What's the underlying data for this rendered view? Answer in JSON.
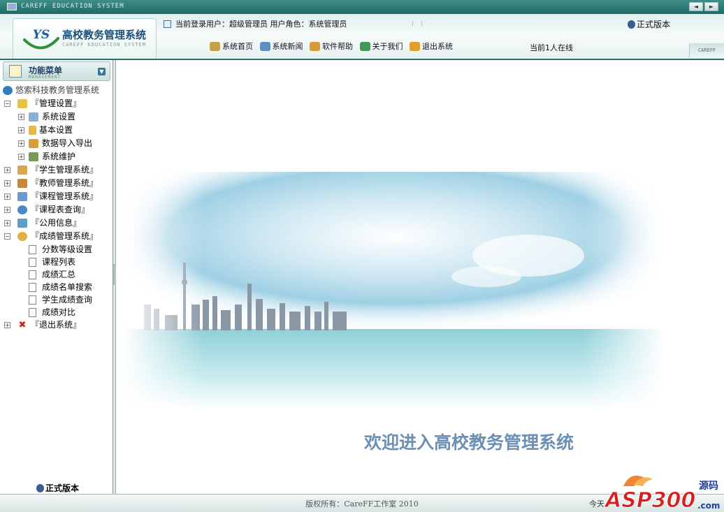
{
  "titlebar": {
    "title": "CAREFF EDUCATION SYSTEM",
    "buttons": [
      "◄",
      "►"
    ]
  },
  "header": {
    "logo_mark": "YS",
    "logo_title": "高校教务管理系统",
    "logo_subtitle": "CAREFF EDUCATION SYSTEM",
    "user_text": "当前登录用户：超级管理员  用户角色：系统管理员",
    "version": "正式版本",
    "nav": [
      {
        "label": "系统首页",
        "icon": "home-icon",
        "color": "#c8a048"
      },
      {
        "label": "系统新闻",
        "icon": "news-icon",
        "color": "#5f8fc0"
      },
      {
        "label": "软件帮助",
        "icon": "help-icon",
        "color": "#d79a38"
      },
      {
        "label": "关于我们",
        "icon": "about-icon",
        "color": "#3f9a58"
      },
      {
        "label": "退出系统",
        "icon": "exit-icon",
        "color": "#e0a030"
      }
    ],
    "online": "当前1人在线",
    "brand_tag": "CAREFF"
  },
  "sidebar": {
    "menu_title": "功能菜单",
    "menu_subtitle": "MANAGEMENT",
    "tree": [
      {
        "label": "悠索科技教务管理系统",
        "level": 0,
        "toggle": "",
        "icon": "globe-icon",
        "color": "#2e7fc0"
      },
      {
        "label": "『管理设置』",
        "level": 0,
        "toggle": "−",
        "icon": "folder-open-icon",
        "color": "#e7c34a"
      },
      {
        "label": "系统设置",
        "level": 1,
        "toggle": "+",
        "icon": "printer-icon",
        "color": "#8ab0d8"
      },
      {
        "label": "基本设置",
        "level": 1,
        "toggle": "+",
        "icon": "pencil-icon",
        "color": "#e8b84a"
      },
      {
        "label": "数据导入导出",
        "level": 1,
        "toggle": "+",
        "icon": "users-icon",
        "color": "#d8a03a"
      },
      {
        "label": "系统维护",
        "level": 1,
        "toggle": "+",
        "icon": "edit-doc-icon",
        "color": "#7a9a5a"
      },
      {
        "label": "『学生管理系统』",
        "level": 0,
        "toggle": "+",
        "icon": "student-icon",
        "color": "#d8a848"
      },
      {
        "label": "『教师管理系统』",
        "level": 0,
        "toggle": "+",
        "icon": "teacher-icon",
        "color": "#c8883a"
      },
      {
        "label": "『课程管理系统』",
        "level": 0,
        "toggle": "+",
        "icon": "table-icon",
        "color": "#6a9ad0"
      },
      {
        "label": "『课程表查询』",
        "level": 0,
        "toggle": "+",
        "icon": "magnifier-icon",
        "color": "#4a8ac8"
      },
      {
        "label": "『公用信息』",
        "level": 0,
        "toggle": "+",
        "icon": "info-icon",
        "color": "#5aa0c8"
      },
      {
        "label": "『成绩管理系统』",
        "level": 0,
        "toggle": "−",
        "icon": "pie-chart-icon",
        "color": "#e0b040"
      }
    ],
    "grade_children": [
      "分数等级设置",
      "课程列表",
      "成绩汇总",
      "成绩名单搜索",
      "学生成绩查询",
      "成绩对比"
    ],
    "exit_item": {
      "label": "『退出系统』",
      "toggle": "+",
      "icon": "close-red-icon",
      "color": "#d02020"
    },
    "version": "正式版本"
  },
  "main": {
    "welcome": "欢迎进入高校教务管理系统"
  },
  "statusbar": {
    "copyright": "版权所有：CareFF工作室 2010",
    "today": "今天"
  },
  "watermark": {
    "text": "ASP300",
    "sub": "源码",
    "domain": ".com"
  }
}
